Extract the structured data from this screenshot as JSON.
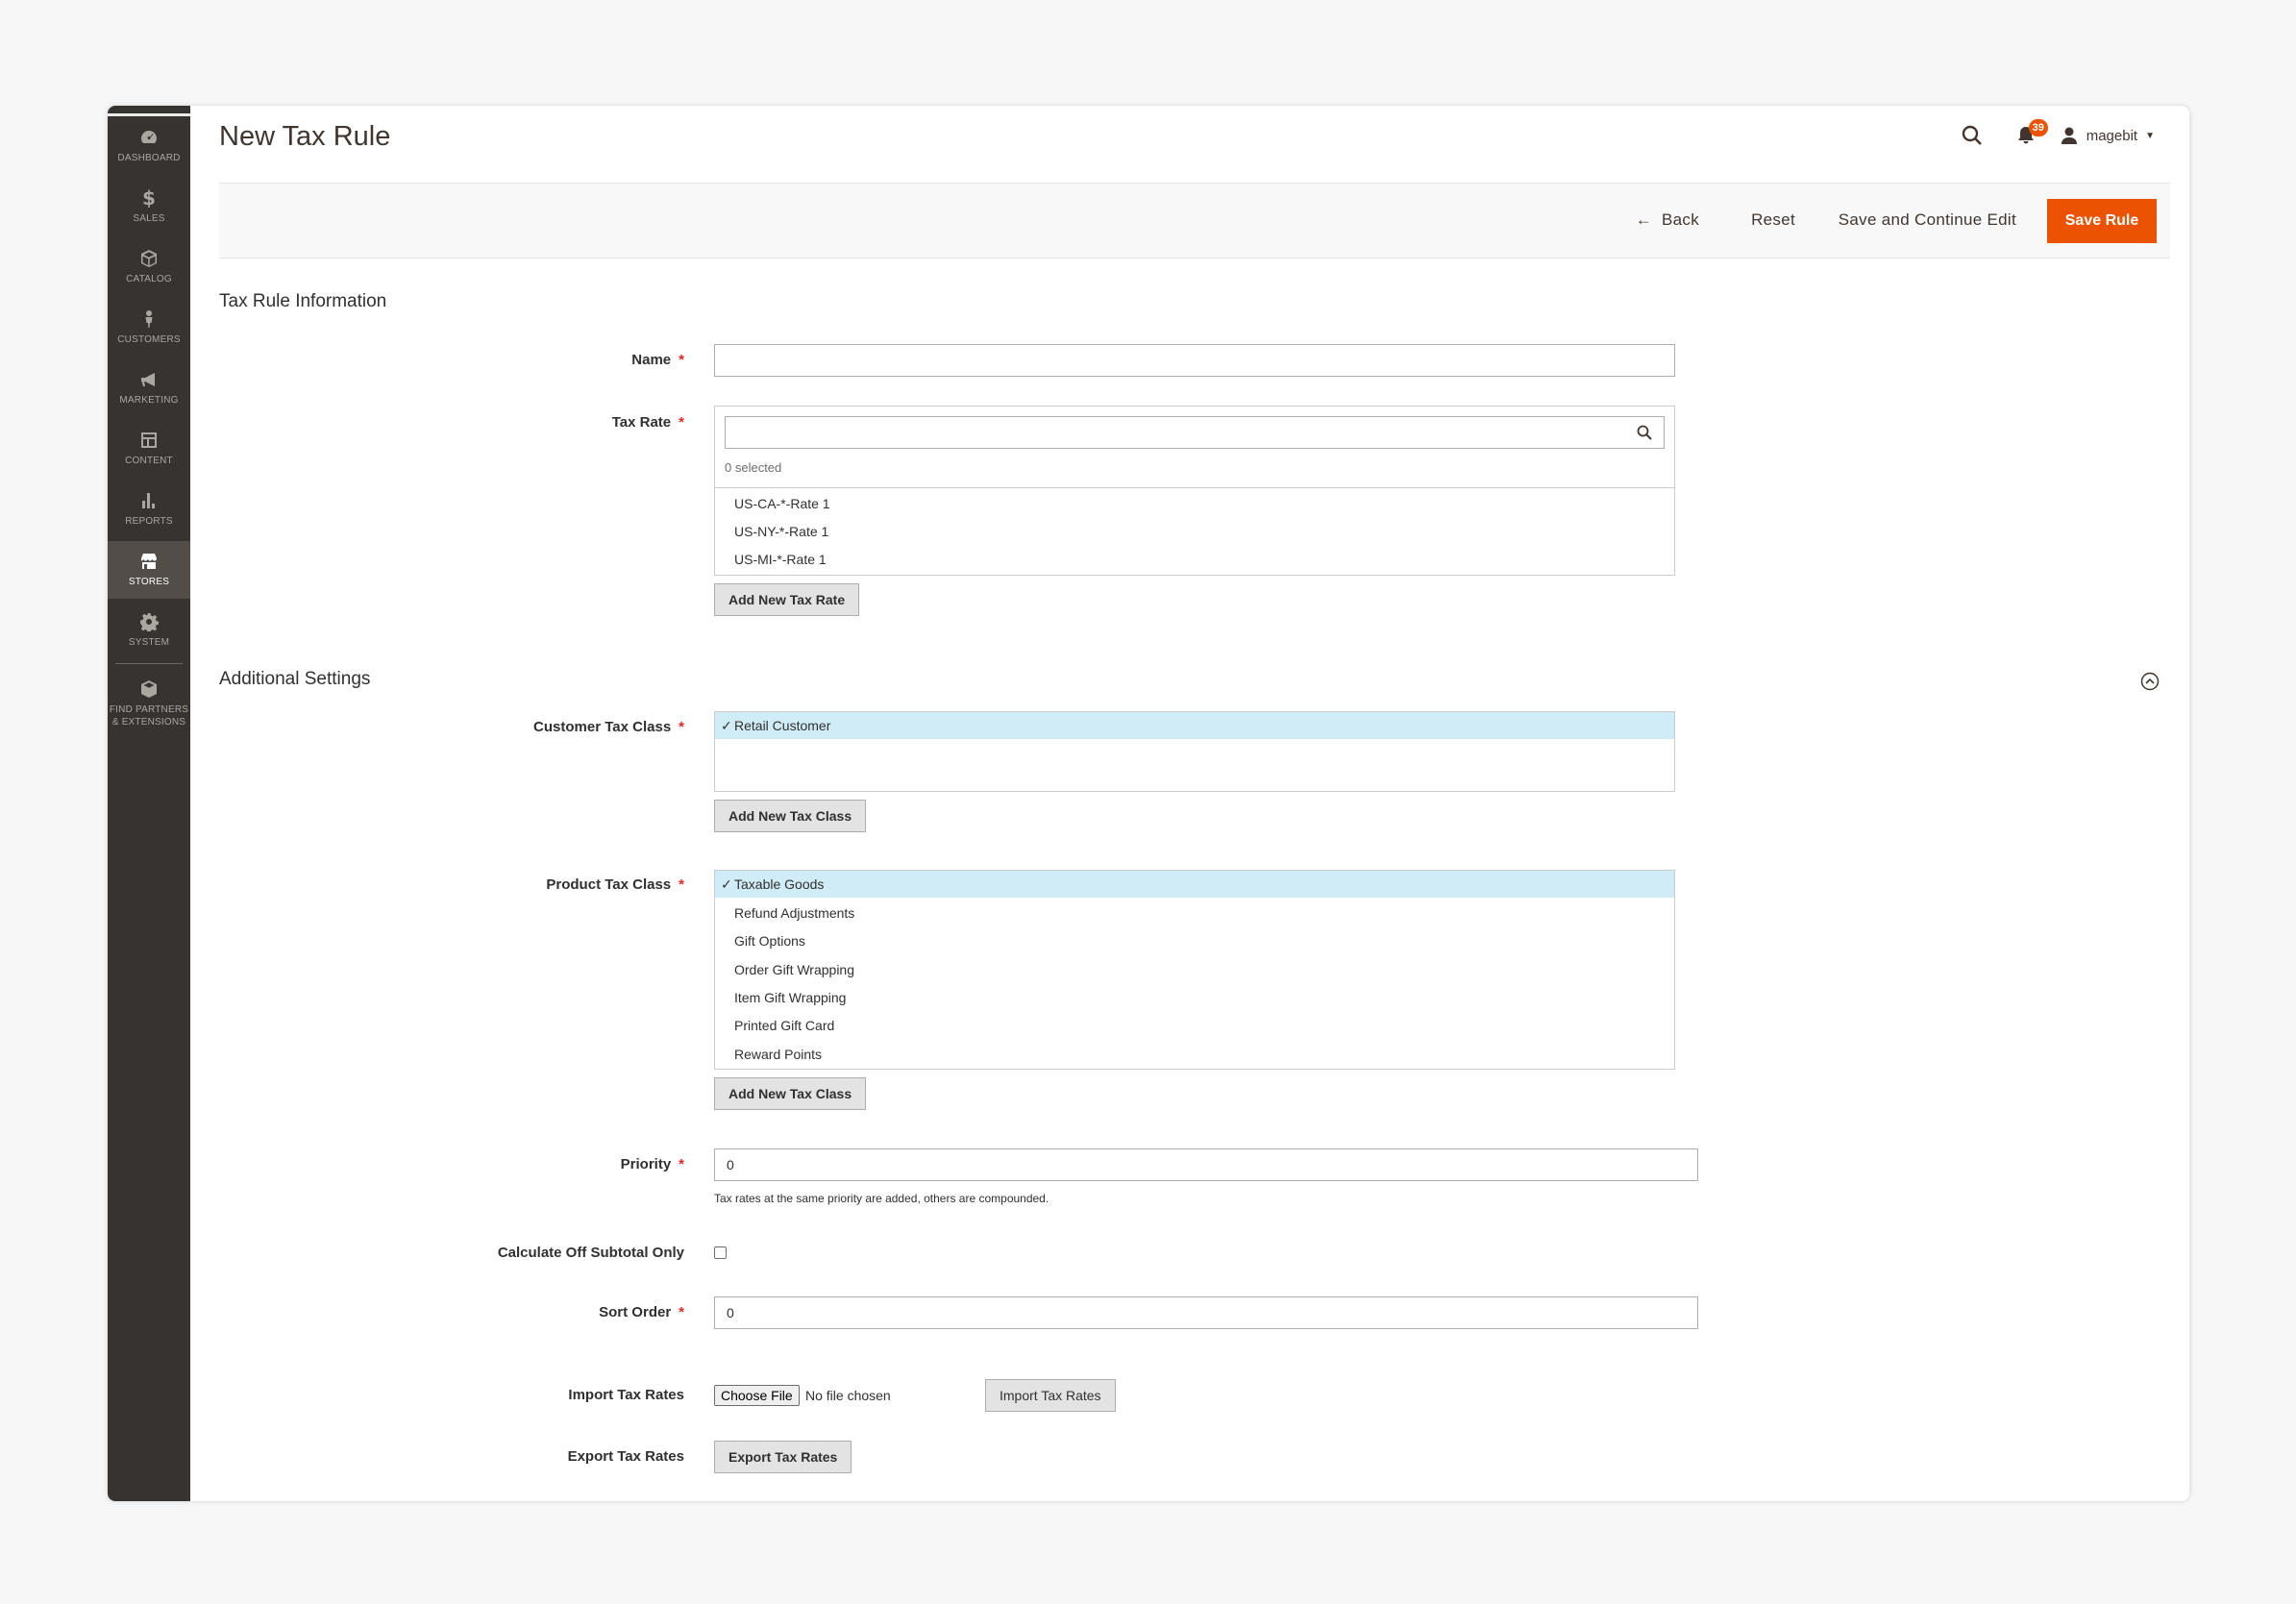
{
  "sidebar": {
    "items": [
      {
        "label": "DASHBOARD",
        "icon": "dashboard-icon"
      },
      {
        "label": "SALES",
        "icon": "dollar-icon"
      },
      {
        "label": "CATALOG",
        "icon": "cube-icon"
      },
      {
        "label": "CUSTOMERS",
        "icon": "person-icon"
      },
      {
        "label": "MARKETING",
        "icon": "megaphone-icon"
      },
      {
        "label": "CONTENT",
        "icon": "layout-icon"
      },
      {
        "label": "REPORTS",
        "icon": "bar-chart-icon"
      },
      {
        "label": "STORES",
        "icon": "storefront-icon"
      },
      {
        "label": "SYSTEM",
        "icon": "gear-icon"
      },
      {
        "label": "FIND PARTNERS & EXTENSIONS",
        "label_line1": "FIND PARTNERS",
        "label_line2": "& EXTENSIONS",
        "icon": "box-icon"
      }
    ],
    "active": "STORES"
  },
  "header": {
    "title": "New Tax Rule",
    "notifications_count": "39",
    "user_name": "magebit"
  },
  "actions": {
    "back": "Back",
    "reset": "Reset",
    "save_continue": "Save and Continue Edit",
    "save": "Save Rule"
  },
  "tax_rule_info": {
    "title": "Tax Rule Information",
    "name_label": "Name",
    "name_value": "",
    "tax_rate_label": "Tax Rate",
    "tax_rate_search": "",
    "selected_text": "0 selected",
    "rates": [
      "US-CA-*-Rate 1",
      "US-NY-*-Rate 1",
      "US-MI-*-Rate 1"
    ],
    "add_rate_button": "Add New Tax Rate"
  },
  "additional": {
    "title": "Additional Settings",
    "customer_class_label": "Customer Tax Class",
    "customer_classes": [
      "Retail Customer"
    ],
    "customer_selected": "Retail Customer",
    "add_customer_class_button": "Add New Tax Class",
    "product_class_label": "Product Tax Class",
    "product_classes": [
      "Taxable Goods",
      "Refund Adjustments",
      "Gift Options",
      "Order Gift Wrapping",
      "Item Gift Wrapping",
      "Printed Gift Card",
      "Reward Points"
    ],
    "product_selected": "Taxable Goods",
    "add_product_class_button": "Add New Tax Class",
    "priority_label": "Priority",
    "priority_value": "0",
    "priority_note": "Tax rates at the same priority are added, others are compounded.",
    "subtotal_label": "Calculate Off Subtotal Only",
    "subtotal_checked": false,
    "sort_order_label": "Sort Order",
    "sort_order_value": "0",
    "import_label": "Import Tax Rates",
    "choose_file": "Choose File",
    "no_file": "No file chosen",
    "import_button": "Import Tax Rates",
    "export_label": "Export Tax Rates",
    "export_button": "Export Tax Rates"
  },
  "colors": {
    "sidebar_bg": "#373330",
    "sidebar_active": "#524d49",
    "accent": "#eb5202",
    "selected_row": "#d0ecf6",
    "required": "#e22626"
  }
}
